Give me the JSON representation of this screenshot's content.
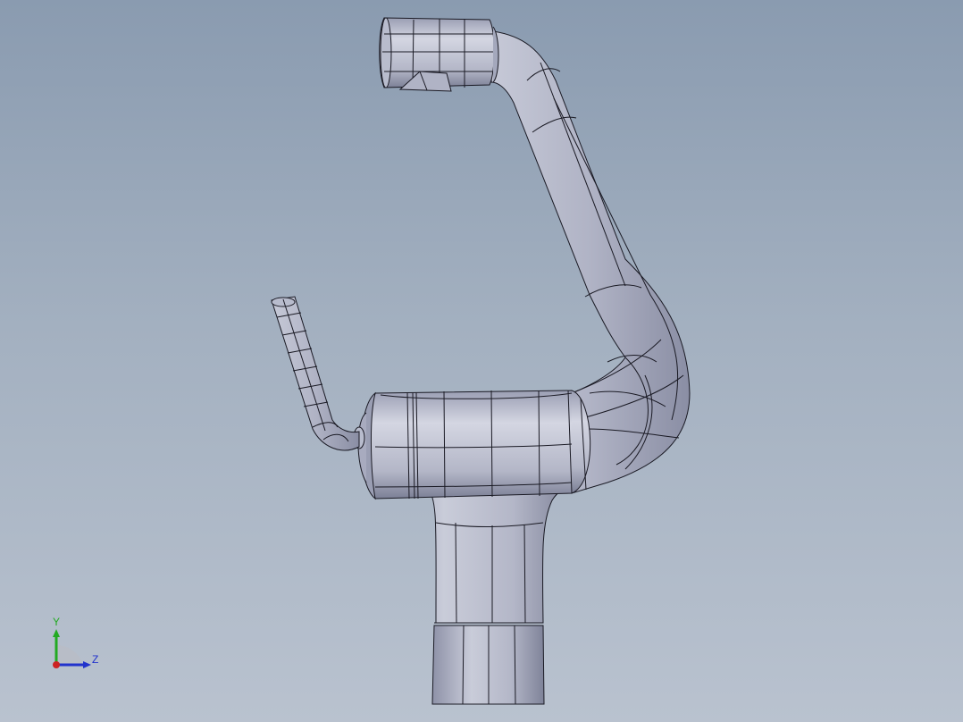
{
  "viewport": {
    "background_top": "#8a9bb0",
    "background_bottom": "#b9c2cf",
    "model": {
      "shading_color": "#b8bccd",
      "edge_color": "#1a1a24"
    }
  },
  "triad": {
    "y_label": "Y",
    "z_label": "Z",
    "y_color": "#22aa22",
    "z_color": "#2233cc",
    "x_color": "#cc2222"
  }
}
